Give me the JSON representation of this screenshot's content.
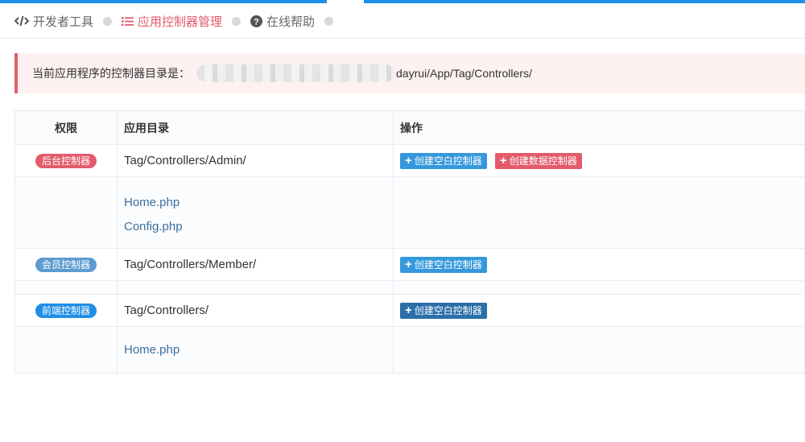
{
  "breadcrumb": [
    {
      "label": "开发者工具",
      "icon": "code-icon"
    },
    {
      "label": "应用控制器管理",
      "icon": "list-icon",
      "active": true
    },
    {
      "label": "在线帮助",
      "icon": "question-circle-icon"
    }
  ],
  "alert": {
    "prefix": "当前应用程序的控制器目录是：",
    "path_visible": "dayrui/App/Tag/Controllers/"
  },
  "table": {
    "headers": [
      "权限",
      "应用目录",
      "操作"
    ],
    "sections": [
      {
        "badge": "后台控制器",
        "badge_color": "#e35b6b",
        "dir": "Tag/Controllers/Admin/",
        "btn_blank": "创建空白控制器",
        "btn_blank_color": "#3598dc",
        "btn_data": "创建数据控制器",
        "btn_data_color": "#e35b6b",
        "files": [
          "Home.php",
          "Config.php"
        ]
      },
      {
        "badge": "会员控制器",
        "badge_color": "#5c9bd1",
        "dir": "Tag/Controllers/Member/",
        "btn_blank": "创建空白控制器",
        "btn_blank_color": "#3598dc",
        "files": []
      },
      {
        "badge": "前端控制器",
        "badge_color": "#1f8ee6",
        "dir": "Tag/Controllers/",
        "btn_blank": "创建空白控制器",
        "btn_blank_color": "#2a6fa8",
        "files": [
          "Home.php"
        ]
      }
    ]
  }
}
